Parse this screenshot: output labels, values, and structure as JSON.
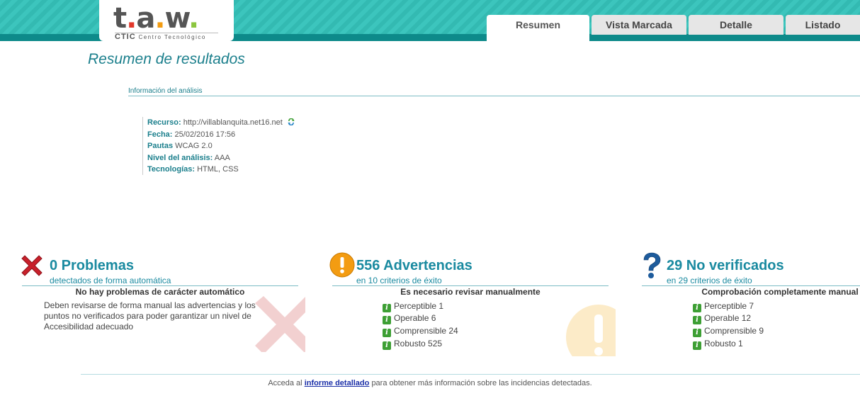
{
  "logo": {
    "main": "t.a.w.",
    "brand": "CTIC",
    "tagline": "Centro Tecnológico"
  },
  "tabs": [
    {
      "label": "Resumen",
      "active": true
    },
    {
      "label": "Vista Marcada",
      "active": false
    },
    {
      "label": "Detalle",
      "active": false
    },
    {
      "label": "Listado",
      "active": false
    }
  ],
  "page_title": "Resumen de resultados",
  "analysis": {
    "section_title": "Información del análisis",
    "resource_label": "Recurso:",
    "resource_value": "http://villablanquita.net16.net",
    "date_label": "Fecha:",
    "date_value": "25/02/2016 17:56",
    "guidelines_label": "Pautas",
    "guidelines_value": "WCAG 2.0",
    "level_label": "Nivel del análisis:",
    "level_value": "AAA",
    "tech_label": "Tecnologías:",
    "tech_value": "HTML, CSS"
  },
  "problems": {
    "title": "0 Problemas",
    "subtitle": "detectados de forma automática",
    "heading": "No hay problemas de carácter automático",
    "text": "Deben revisarse de forma manual las advertencias y los puntos no verificados para poder garantizar un nivel de Accesibilidad adecuado"
  },
  "warnings": {
    "title": "556 Advertencias",
    "subtitle": "en 10 criterios de éxito",
    "heading": "Es necesario revisar manualmente",
    "items": [
      "Perceptible 1",
      "Operable 6",
      "Comprensible 24",
      "Robusto 525"
    ]
  },
  "unverified": {
    "title": "29 No verificados",
    "subtitle": "en 29 criterios de éxito",
    "heading": "Comprobación completamente manual",
    "items": [
      "Perceptible 7",
      "Operable 12",
      "Comprensible 9",
      "Robusto 1"
    ]
  },
  "footer": {
    "prefix": "Acceda al",
    "link": "informe detallado",
    "suffix": "para obtener más información sobre las incidencias detectadas."
  },
  "colors": {
    "teal_band": "#3cc5bd",
    "teal_dark": "#0d8a8a",
    "title_teal": "#1b7f8c",
    "result_blue": "#1a8aa0",
    "error_red": "#c8202b",
    "warn_orange": "#f39c12",
    "question_blue": "#1d5b9c",
    "info_green": "#3d9f34"
  },
  "icons": [
    "red-x-icon",
    "exclamation-icon",
    "question-icon",
    "info-icon",
    "refresh-icon"
  ]
}
